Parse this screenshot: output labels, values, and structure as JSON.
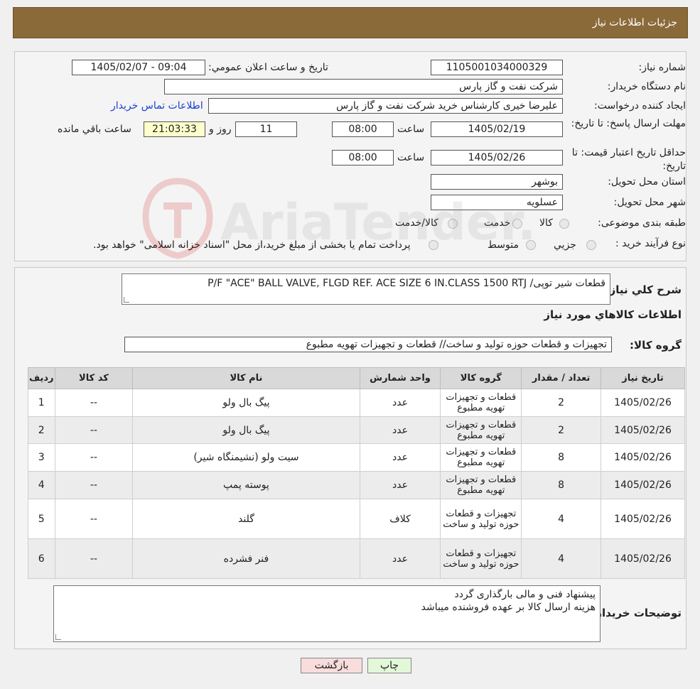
{
  "header": {
    "title": "جزئیات اطلاعات نیاز"
  },
  "form": {
    "need_number_label": "شماره نیاز:",
    "need_number": "1105001034000329",
    "announce_label": "تاریخ و ساعت اعلان عمومي:",
    "announce_value": "1405/02/07 - 09:04",
    "buyer_org_label": "نام دستگاه خريدار:",
    "buyer_org": "شرکت نفت و گاز پارس",
    "creator_label": "ايجاد کننده درخواست:",
    "creator": "عليرضا  خيری کارشناس خريد  شرکت نفت و گاز پارس",
    "contact_link": "اطلاعات تماس خريدار",
    "deadline_label": "مهلت ارسال پاسخ: تا تاريخ:",
    "deadline_date": "1405/02/19",
    "time_label": "ساعت",
    "deadline_time": "08:00",
    "days_value": "11",
    "days_label": "روز و",
    "remaining_value": "21:03:33",
    "remaining_label": "ساعت باقي مانده",
    "validity_label": "حداقل تاريخ اعتبار قيمت: تا تاريخ:",
    "validity_date": "1405/02/26",
    "validity_time": "08:00",
    "province_label": "استان محل تحويل:",
    "province": "بوشهر",
    "city_label": "شهر محل تحويل:",
    "city": "عسلويه",
    "category_label": "طبقه بندی موضوعی:",
    "category_options": [
      "کالا",
      "خدمت",
      "کالا/خدمت"
    ],
    "process_label": "نوع فرآيند خريد :",
    "process_options": [
      "جزيي",
      "متوسط"
    ],
    "process_note": "پرداخت تمام يا بخشی از مبلغ خريد،از محل \"اسناد خزانه اسلامی\" خواهد بود."
  },
  "summary": {
    "label": "شرح کلي نياز:",
    "text": "P/F \"ACE\" BALL VALVE, FLGD REF. ACE SIZE 6 IN.CLASS 1500 RTJ /قطعات شير توپی",
    "goods_title": "اطلاعات کالاهاي مورد نياز",
    "group_label": "گروه کالا:",
    "group_value": "تجهيزات و قطعات حوزه توليد و ساخت//  قطعات و تجهيزات تهويه مطبوع"
  },
  "table": {
    "headers": [
      "رديف",
      "کد کالا",
      "نام کالا",
      "واحد شمارش",
      "گروه کالا",
      "تعداد / مقدار",
      "تاريخ نياز"
    ],
    "rows": [
      [
        "1",
        "--",
        "پيگ بال ولو",
        "عدد",
        "قطعات و تجهيزات تهويه مطبوع",
        "2",
        "1405/02/26"
      ],
      [
        "2",
        "--",
        "پيگ بال ولو",
        "عدد",
        "قطعات و تجهيزات تهويه مطبوع",
        "2",
        "1405/02/26"
      ],
      [
        "3",
        "--",
        "سيت ولو (نشيمنگاه شير)",
        "عدد",
        "قطعات و تجهيزات تهويه مطبوع",
        "8",
        "1405/02/26"
      ],
      [
        "4",
        "--",
        "پوسته پمپ",
        "عدد",
        "قطعات و تجهيزات تهويه مطبوع",
        "8",
        "1405/02/26"
      ],
      [
        "5",
        "--",
        "گلند",
        "کلاف",
        "تجهيزات و قطعات حوزه توليد و ساخت",
        "4",
        "1405/02/26"
      ],
      [
        "6",
        "--",
        "فنر فشرده",
        "عدد",
        "تجهيزات و قطعات حوزه توليد و ساخت",
        "4",
        "1405/02/26"
      ]
    ]
  },
  "notes": {
    "label": "توضيحات خريدار:",
    "line1": "پيشنهاد فنی و مالی بارگذاری گردد",
    "line2": "هزينه ارسال کالا بر عهده فروشنده ميباشد"
  },
  "buttons": {
    "print": "چاپ",
    "back": "بازگشت"
  },
  "watermark": {
    "text": "AriaTender.neT"
  }
}
